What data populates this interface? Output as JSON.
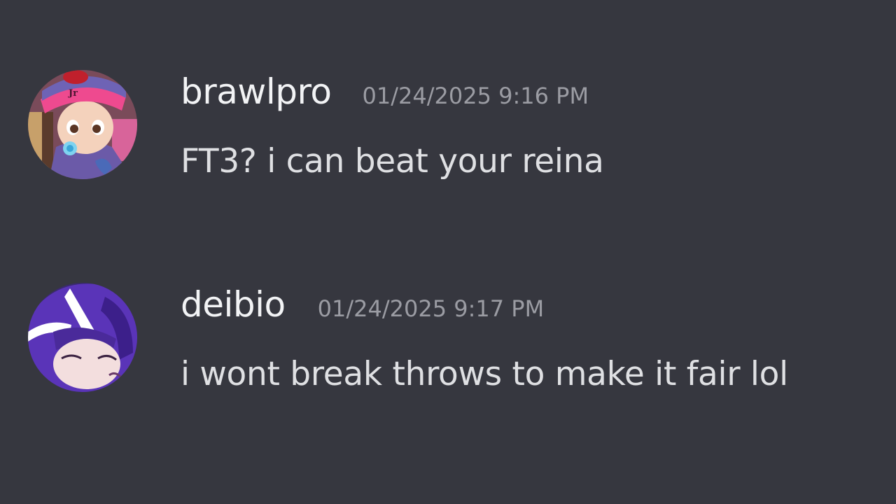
{
  "messages": [
    {
      "username": "brawlpro",
      "timestamp": "01/24/2025 9:16 PM",
      "content": "FT3? i can beat your reina",
      "avatar_icon": "baby-character-avatar",
      "avatar_text": "Jr"
    },
    {
      "username": "deibio",
      "timestamp": "01/24/2025 9:17 PM",
      "content": "i wont break throws to make it fair lol",
      "avatar_icon": "hooded-character-avatar"
    }
  ],
  "colors": {
    "background": "#36373f",
    "username": "#f2f3f5",
    "timestamp": "#9b9ca3",
    "content": "#dfe0e3"
  }
}
